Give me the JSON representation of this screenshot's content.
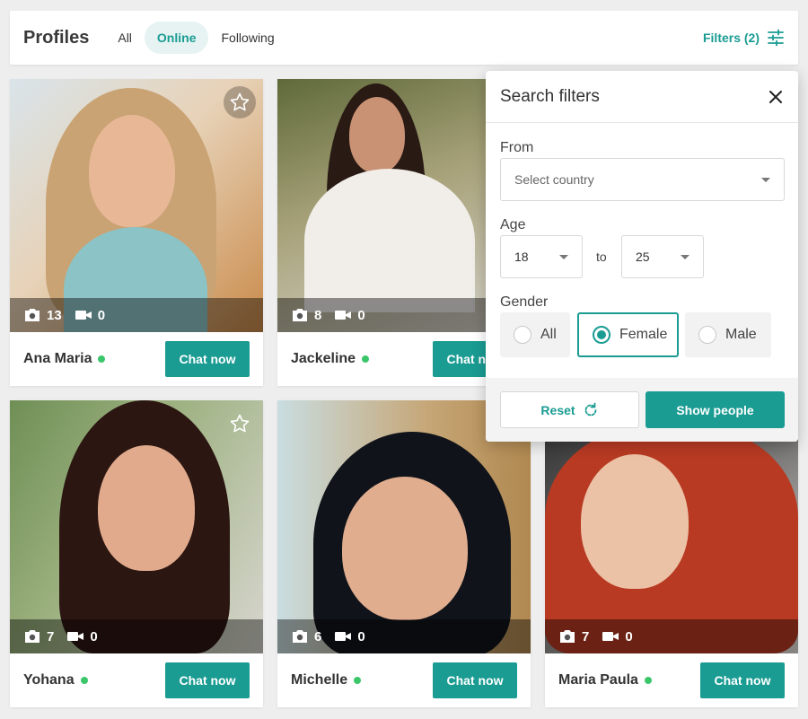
{
  "header": {
    "title": "Profiles",
    "tabs": [
      {
        "label": "All",
        "active": false
      },
      {
        "label": "Online",
        "active": true
      },
      {
        "label": "Following",
        "active": false
      }
    ],
    "filters_label": "Filters (2)"
  },
  "profiles": [
    {
      "name": "Ana Maria",
      "photos": "13",
      "videos": "0",
      "online": true,
      "chat_label": "Chat now"
    },
    {
      "name": "Jackeline",
      "photos": "8",
      "videos": "0",
      "online": true,
      "chat_label": "Chat now"
    },
    {
      "name": "Yohana",
      "photos": "7",
      "videos": "0",
      "online": true,
      "chat_label": "Chat now"
    },
    {
      "name": "Michelle",
      "photos": "6",
      "videos": "0",
      "online": true,
      "chat_label": "Chat now"
    },
    {
      "name": "Maria Paula",
      "photos": "7",
      "videos": "0",
      "online": true,
      "chat_label": "Chat now"
    }
  ],
  "filters": {
    "title": "Search filters",
    "from_label": "From",
    "country_placeholder": "Select country",
    "age_label": "Age",
    "age_min": "18",
    "age_to": "to",
    "age_max": "25",
    "gender_label": "Gender",
    "gender_options": [
      {
        "label": "All",
        "selected": false
      },
      {
        "label": "Female",
        "selected": true
      },
      {
        "label": "Male",
        "selected": false
      }
    ],
    "reset_label": "Reset",
    "show_label": "Show people"
  },
  "colors": {
    "accent": "#1a9c93",
    "online": "#3cc66a",
    "background": "#eeeeee"
  },
  "icons": {
    "photo": "camera-icon",
    "video": "video-camera-icon",
    "favorite": "star-icon",
    "filters": "sliders-icon",
    "close": "close-icon",
    "reset": "refresh-icon"
  }
}
